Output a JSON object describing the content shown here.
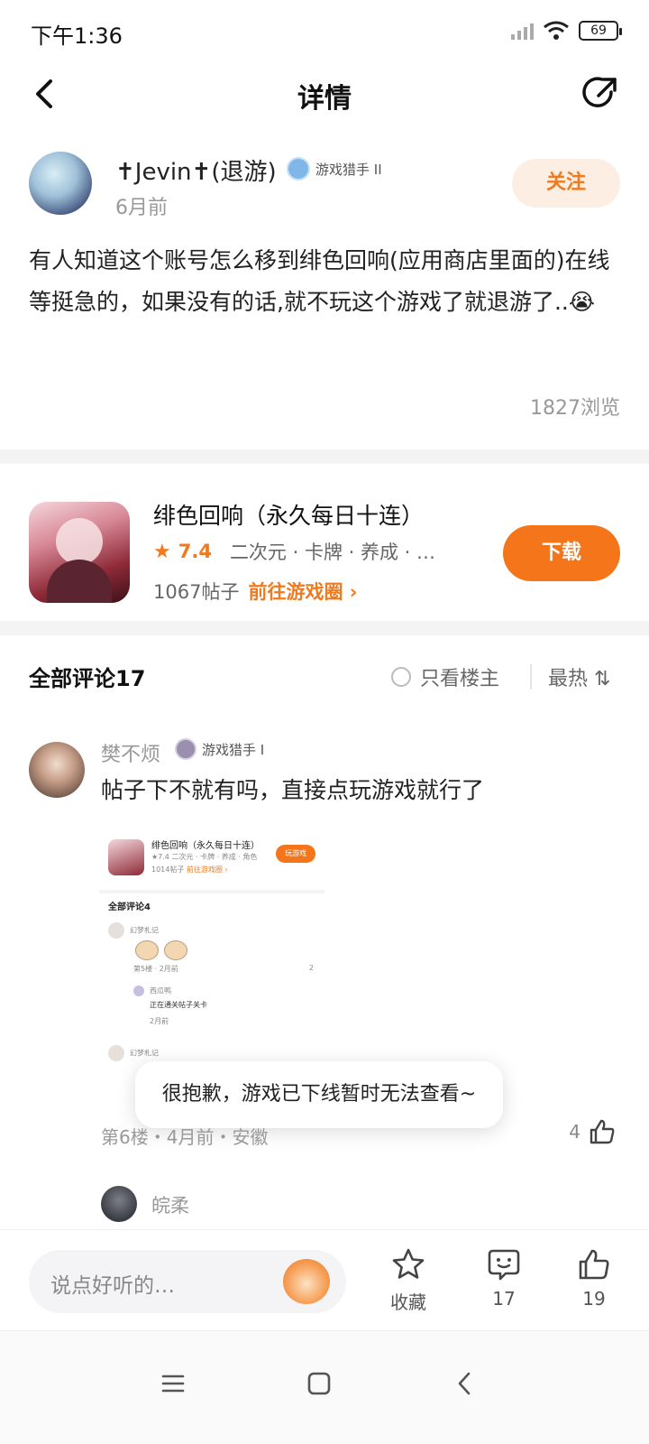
{
  "status": {
    "time": "下午1:36",
    "battery": "69"
  },
  "nav": {
    "title": "详情"
  },
  "post": {
    "author": "✝Jevin✝(退游)",
    "badge": "游戏猎手 II",
    "time": "6月前",
    "follow": "关注",
    "body": "有人知道这个账号怎么移到绯色回响(应用商店里面的)在线等挺急的，如果没有的话,就不玩这个游戏了就退游了..😭",
    "views": "1827浏览"
  },
  "game": {
    "title": "绯色回响（永久每日十连）",
    "rating": "7.4",
    "tags": "二次元 · 卡牌 · 养成 · …",
    "posts": "1067帖子",
    "link": "前往游戏圈 ›",
    "download": "下载"
  },
  "comments": {
    "title": "全部评论17",
    "only_op": "只看楼主",
    "sort": "最热 ⇅"
  },
  "comment": {
    "name": "樊不烦",
    "badge": "游戏猎手 I",
    "text": "帖子下不就有吗，直接点玩游戏就行了",
    "footer": "第6楼・4月前・安徽",
    "likes": "4"
  },
  "screenshot": {
    "title": "绯色回响（永久每日十连）",
    "meta": "★7.4 二次元 · 卡牌 · 养成 · 角色",
    "posts": "1014帖子",
    "link": "前往游戏圈 ›",
    "btn": "玩游戏",
    "section": "全部评论4",
    "user1": "幻梦札记",
    "meta1": "第5楼 · 2月前",
    "likes1": "2",
    "user2": "西瓜鸭",
    "reply2": "正在通关帖子关卡",
    "time2": "2月前",
    "user3": "幻梦札记"
  },
  "toast": {
    "text": "很抱歉，游戏已下线暂时无法查看~"
  },
  "reply": {
    "name": "皖柔"
  },
  "bottom": {
    "placeholder": "说点好听的…",
    "fav_label": "收藏",
    "comment_count": "17",
    "like_count": "19"
  }
}
